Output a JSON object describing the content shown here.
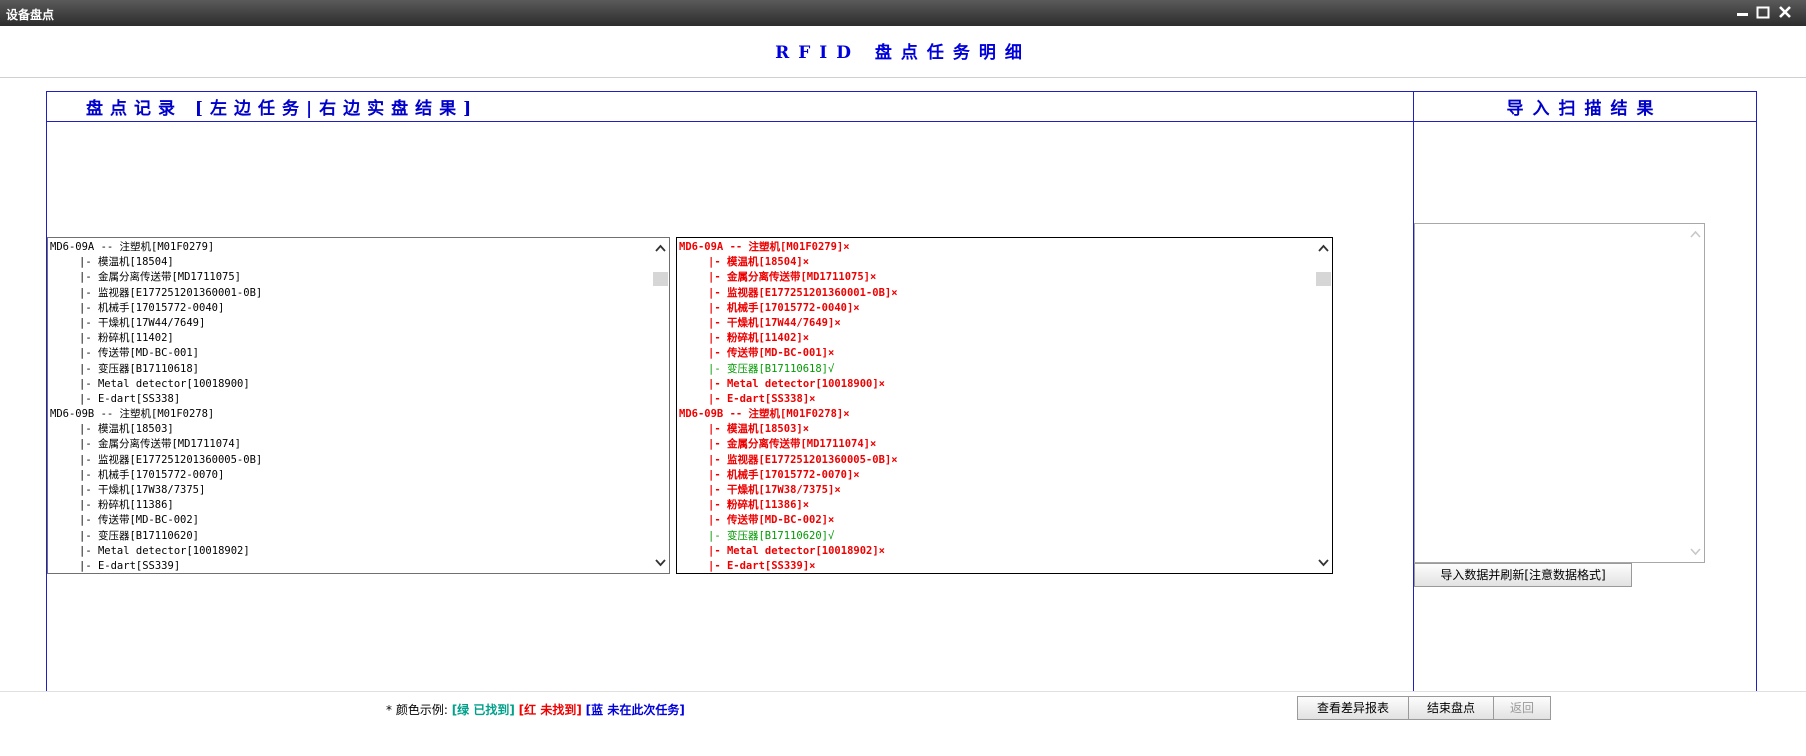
{
  "window": {
    "title": "设备盘点"
  },
  "header": {
    "title": "RFID 盘点任务明细"
  },
  "sections": {
    "left_title": "盘点记录 [左边任务|右边实盘结果]",
    "right_title": "导入扫描结果"
  },
  "task_list": [
    {
      "text": "MD6-09A -- 注塑机[M01F0279]",
      "indent": false
    },
    {
      "text": "|- 模温机[18504]",
      "indent": true
    },
    {
      "text": "|- 金属分离传送带[MD1711075]",
      "indent": true
    },
    {
      "text": "|- 监视器[E177251201360001-0B]",
      "indent": true
    },
    {
      "text": "|- 机械手[17015772-0040]",
      "indent": true
    },
    {
      "text": "|- 干燥机[17W44/7649]",
      "indent": true
    },
    {
      "text": "|- 粉碎机[11402]",
      "indent": true
    },
    {
      "text": "|- 传送带[MD-BC-001]",
      "indent": true
    },
    {
      "text": "|- 变压器[B17110618]",
      "indent": true
    },
    {
      "text": "|- Metal detector[10018900]",
      "indent": true
    },
    {
      "text": "|- E-dart[SS338]",
      "indent": true
    },
    {
      "text": "MD6-09B -- 注塑机[M01F0278]",
      "indent": false
    },
    {
      "text": "|- 模温机[18503]",
      "indent": true
    },
    {
      "text": "|- 金属分离传送带[MD1711074]",
      "indent": true
    },
    {
      "text": "|- 监视器[E177251201360005-0B]",
      "indent": true
    },
    {
      "text": "|- 机械手[17015772-0070]",
      "indent": true
    },
    {
      "text": "|- 干燥机[17W38/7375]",
      "indent": true
    },
    {
      "text": "|- 粉碎机[11386]",
      "indent": true
    },
    {
      "text": "|- 传送带[MD-BC-002]",
      "indent": true
    },
    {
      "text": "|- 变压器[B17110620]",
      "indent": true
    },
    {
      "text": "|- Metal detector[10018902]",
      "indent": true
    },
    {
      "text": "|- E-dart[SS339]",
      "indent": true
    }
  ],
  "result_list": [
    {
      "text": "MD6-09A -- 注塑机[M01F0279]×",
      "indent": false,
      "status": "red"
    },
    {
      "text": "|- 模温机[18504]×",
      "indent": true,
      "status": "red"
    },
    {
      "text": "|- 金属分离传送带[MD1711075]×",
      "indent": true,
      "status": "red"
    },
    {
      "text": "|- 监视器[E177251201360001-0B]×",
      "indent": true,
      "status": "red"
    },
    {
      "text": "|- 机械手[17015772-0040]×",
      "indent": true,
      "status": "red"
    },
    {
      "text": "|- 干燥机[17W44/7649]×",
      "indent": true,
      "status": "red"
    },
    {
      "text": "|- 粉碎机[11402]×",
      "indent": true,
      "status": "red"
    },
    {
      "text": "|- 传送带[MD-BC-001]×",
      "indent": true,
      "status": "red"
    },
    {
      "text": "|- 变压器[B17110618]√",
      "indent": true,
      "status": "green"
    },
    {
      "text": "|- Metal detector[10018900]×",
      "indent": true,
      "status": "red"
    },
    {
      "text": "|- E-dart[SS338]×",
      "indent": true,
      "status": "red"
    },
    {
      "text": "MD6-09B -- 注塑机[M01F0278]×",
      "indent": false,
      "status": "red"
    },
    {
      "text": "|- 模温机[18503]×",
      "indent": true,
      "status": "red"
    },
    {
      "text": "|- 金属分离传送带[MD1711074]×",
      "indent": true,
      "status": "red"
    },
    {
      "text": "|- 监视器[E177251201360005-0B]×",
      "indent": true,
      "status": "red"
    },
    {
      "text": "|- 机械手[17015772-0070]×",
      "indent": true,
      "status": "red"
    },
    {
      "text": "|- 干燥机[17W38/7375]×",
      "indent": true,
      "status": "red"
    },
    {
      "text": "|- 粉碎机[11386]×",
      "indent": true,
      "status": "red"
    },
    {
      "text": "|- 传送带[MD-BC-002]×",
      "indent": true,
      "status": "red"
    },
    {
      "text": "|- 变压器[B17110620]√",
      "indent": true,
      "status": "green"
    },
    {
      "text": "|- Metal detector[10018902]×",
      "indent": true,
      "status": "red"
    },
    {
      "text": "|- E-dart[SS339]×",
      "indent": true,
      "status": "red"
    }
  ],
  "import": {
    "textarea_value": "",
    "button_label": "导入数据并刷新[注意数据格式]"
  },
  "legend": {
    "prefix": "* 颜色示例:",
    "green": "[绿 已找到]",
    "red": "[红 未找到]",
    "blue": "[蓝 未在此次任务]"
  },
  "footer_buttons": {
    "diff_report": "查看差异报表",
    "finish": "结束盘点",
    "back": "返回"
  },
  "colors": {
    "found": "#009a00",
    "not_found": "#ee0000",
    "not_in_task": "#0000dd",
    "title_blue": "#0000dd"
  }
}
